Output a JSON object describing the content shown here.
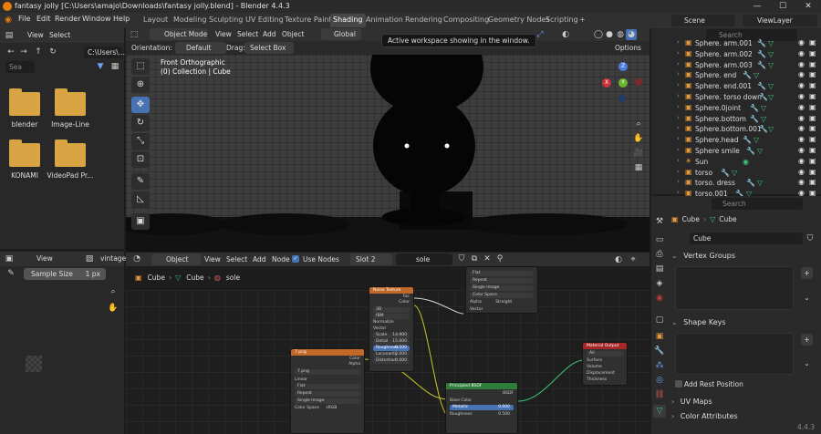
{
  "window": {
    "title": "fantasy jolly [C:\\Users\\amajo\\Downloads\\fantasy jolly.blend] - Blender 4.4.3",
    "minimize": "—",
    "maximize": "☐",
    "close": "✕"
  },
  "menubar": {
    "items": [
      "File",
      "Edit",
      "Render",
      "Window",
      "Help"
    ],
    "workspaces": [
      "Layout",
      "Modeling",
      "Sculpting",
      "UV Editing",
      "Texture Paint",
      "Shading",
      "Animation",
      "Rendering",
      "Compositing",
      "Geometry Nodes",
      "Scripting"
    ],
    "active_workspace": "Shading",
    "add_tab": "+",
    "scene_label": "Scene",
    "viewlayer_label": "ViewLayer"
  },
  "tooltip": "Active workspace showing in the window.",
  "file_browser": {
    "view": "View",
    "select": "Select",
    "path": "C:\\Users\\...",
    "search_placeholder": "Sea",
    "folders": [
      "blender",
      "Image-Line",
      "KONAMI",
      "VideoPad Pr..."
    ]
  },
  "viewport": {
    "mode": "Object Mode",
    "menus": [
      "View",
      "Select",
      "Add",
      "Object"
    ],
    "orientation_label": "Orientation:",
    "orientation_value": "Default",
    "drag_label": "Drag:",
    "drag_value": "Select Box",
    "transform": "Global",
    "options": "Options",
    "view_name": "Front Orthographic",
    "collection_info": "(0) Collection | Cube",
    "gizmo": {
      "z": "Z",
      "x": "X",
      "y": "Y"
    }
  },
  "outliner": {
    "search_placeholder": "Search",
    "rows": [
      "Sphere. arm.001",
      "Sphere. arm.002",
      "Sphere. arm.003",
      "Sphere. end",
      "Sphere. end.001",
      "Sphere. torso down",
      "Sphere.0joint",
      "Sphere.bottom",
      "Sphere.bottom.001",
      "Sphere.head",
      "Sphere smile",
      "Sun",
      "torso",
      "torso. dress",
      "torso.001"
    ]
  },
  "properties": {
    "search_placeholder": "Search",
    "breadcrumb_object": "Cube",
    "breadcrumb_mesh": "Cube",
    "data_name": "Cube",
    "vertex_groups": "Vertex Groups",
    "shape_keys": "Shape Keys",
    "add_rest_position": "Add Rest Position",
    "uv_maps": "UV Maps",
    "color_attributes": "Color Attributes"
  },
  "image_editor": {
    "view": "View",
    "image_name": "vintage",
    "sample_size_label": "Sample Size",
    "sample_size_value": "1 px"
  },
  "node_editor": {
    "object": "Object",
    "menus": [
      "View",
      "Select",
      "Add",
      "Node"
    ],
    "use_nodes": "Use Nodes",
    "slot": "Slot 2",
    "material": "sole",
    "breadcrumb": [
      "Cube",
      "Cube",
      "sole"
    ],
    "noise_node": {
      "title": "Noise Texture",
      "outputs": [
        "Fac",
        "Color"
      ],
      "dim": "3D",
      "type": "fBM",
      "normalize": "Normalize",
      "vector": "Vector",
      "fields": [
        {
          "label": "Scale",
          "value": "14.900"
        },
        {
          "label": "Detail",
          "value": "15.000"
        },
        {
          "label": "Roughness",
          "value": "0.500"
        },
        {
          "label": "Lacunarity",
          "value": "2.000"
        },
        {
          "label": "Distortion",
          "value": "0.000"
        }
      ]
    },
    "image_node": {
      "title": "7.png",
      "outputs": [
        "Color",
        "Alpha"
      ],
      "image": "7.png",
      "options": [
        "Linear",
        "Flat",
        "Repeat",
        "Single Image"
      ],
      "color_space_label": "Color Space",
      "color_space_value": "sRGB"
    },
    "tex_node": {
      "options": [
        "Flat",
        "Repeat",
        "Single Image"
      ],
      "color_space_label": "Color Space",
      "alpha_label": "Alpha",
      "alpha_value": "Straight",
      "vector": "Vector"
    },
    "bsdf_node": {
      "title": "Principled BSDF",
      "output": "BSDF",
      "inputs": [
        "Base Color",
        "Metallic",
        "Roughness"
      ],
      "metallic_value": "0.000",
      "roughness_value": "0.500"
    },
    "output_node": {
      "title": "Material Output",
      "target": "All",
      "inputs": [
        "Surface",
        "Volume",
        "Displacement",
        "Thickness"
      ]
    }
  },
  "version": "4.4.3",
  "colors": {
    "accent": "#4772b3",
    "folder": "#d9a444",
    "orange_logo": "#e87d0d",
    "node_texture": "#c2692a",
    "node_shader": "#2e7d3a",
    "node_output": "#a52727"
  }
}
